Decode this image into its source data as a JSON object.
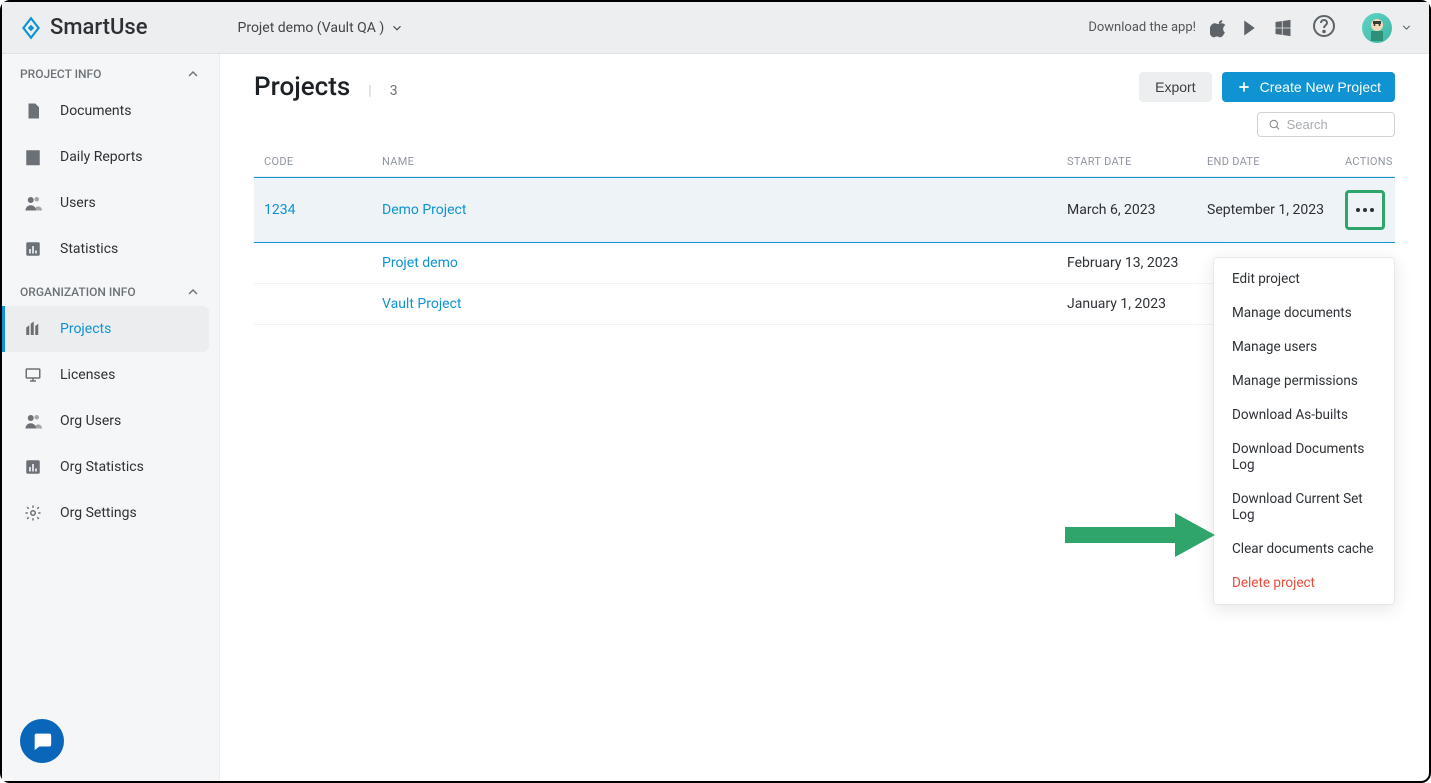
{
  "app_name": "SmartUse",
  "header": {
    "project_name": "Projet demo (Vault QA )",
    "download_text": "Download the app!"
  },
  "sidebar": {
    "section1_label": "PROJECT INFO",
    "section2_label": "ORGANIZATION INFO",
    "items": {
      "documents": "Documents",
      "daily_reports": "Daily Reports",
      "users": "Users",
      "statistics": "Statistics",
      "projects": "Projects",
      "licenses": "Licenses",
      "org_users": "Org Users",
      "org_statistics": "Org Statistics",
      "org_settings": "Org Settings"
    }
  },
  "main": {
    "title": "Projects",
    "count": "3",
    "divider": "|",
    "export_label": "Export",
    "create_label": "Create New Project",
    "search_placeholder": "Search"
  },
  "table": {
    "headers": {
      "code": "CODE",
      "name": "NAME",
      "start": "START DATE",
      "end": "END DATE",
      "actions": "ACTIONS"
    },
    "rows": [
      {
        "code": "1234",
        "name": "Demo Project",
        "start": "March 6, 2023",
        "end": "September 1, 2023"
      },
      {
        "code": "",
        "name": "Projet demo",
        "start": "February 13, 2023",
        "end": ""
      },
      {
        "code": "",
        "name": "Vault Project",
        "start": "January 1, 2023",
        "end": ""
      }
    ]
  },
  "dropdown": {
    "edit": "Edit project",
    "manage_documents": "Manage documents",
    "manage_users": "Manage users",
    "manage_permissions": "Manage permissions",
    "download_asbuilts": "Download As-builts",
    "download_docs_log": "Download Documents Log",
    "download_set_log": "Download Current Set Log",
    "clear_cache": "Clear documents cache",
    "delete": "Delete project"
  }
}
